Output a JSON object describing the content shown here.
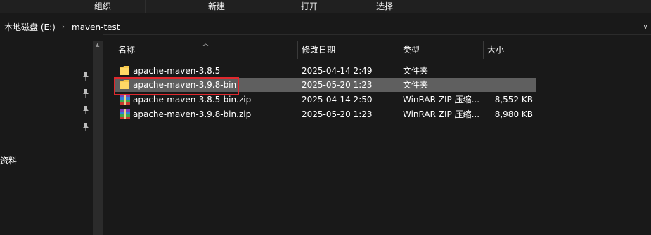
{
  "ribbon": {
    "groups": [
      "组织",
      "新建",
      "打开",
      "选择"
    ]
  },
  "address_bar": {
    "segments": [
      "本地磁盘 (E:)",
      "maven-test"
    ],
    "separator": "›",
    "dropdown": "∨"
  },
  "nav": {
    "visible_label": "资料"
  },
  "columns": {
    "name": "名称",
    "modified": "修改日期",
    "type": "类型",
    "size": "大小"
  },
  "files": [
    {
      "name": "apache-maven-3.8.5",
      "modified": "2025-04-14 2:49",
      "type": "文件夹",
      "size": "",
      "icon": "folder-icon"
    },
    {
      "name": "apache-maven-3.9.8-bin",
      "modified": "2025-05-20 1:23",
      "type": "文件夹",
      "size": "",
      "icon": "folder-icon",
      "selected": true
    },
    {
      "name": "apache-maven-3.8.5-bin.zip",
      "modified": "2025-04-14 2:50",
      "type": "WinRAR ZIP 压缩...",
      "size": "8,552 KB",
      "icon": "winrar-zip-icon"
    },
    {
      "name": "apache-maven-3.9.8-bin.zip",
      "modified": "2025-05-20 1:23",
      "type": "WinRAR ZIP 压缩...",
      "size": "8,980 KB",
      "icon": "winrar-zip-icon"
    }
  ],
  "colors": {
    "background": "#191919",
    "selection": "#5f5f5f",
    "highlight_border": "#e0282d",
    "folder": "#f6c94d"
  }
}
